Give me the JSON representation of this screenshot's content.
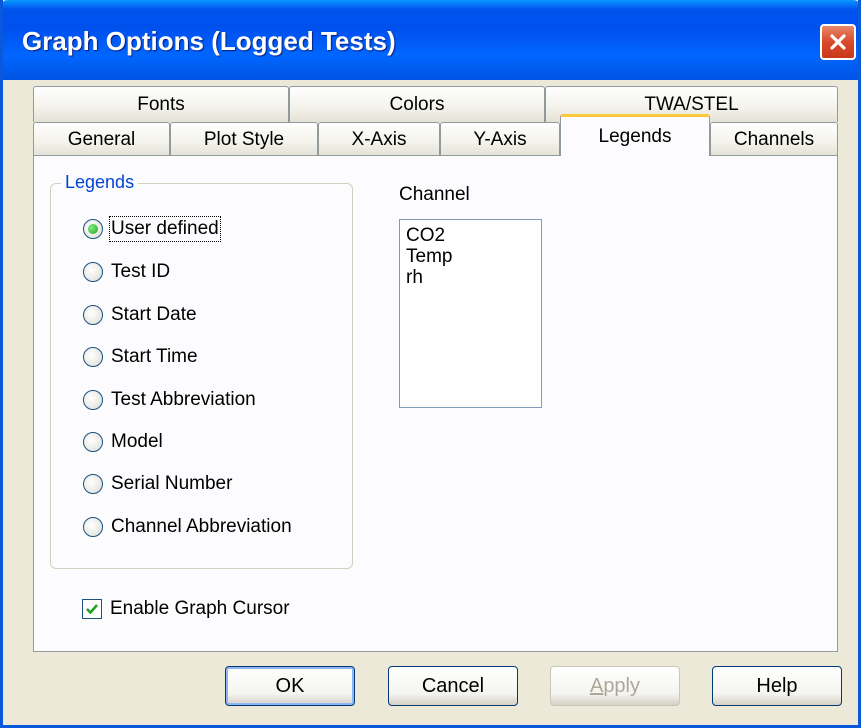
{
  "window": {
    "title": "Graph Options (Logged Tests)"
  },
  "tabs": {
    "row_back": [
      "Fonts",
      "Colors",
      "TWA/STEL"
    ],
    "row_front": [
      "General",
      "Plot Style",
      "X-Axis",
      "Y-Axis",
      "Legends",
      "Channels"
    ],
    "selected": "Legends"
  },
  "legends_group": {
    "label": "Legends",
    "options": [
      "User defined",
      "Test ID",
      "Start Date",
      "Start Time",
      "Test Abbreviation",
      "Model",
      "Serial Number",
      "Channel Abbreviation"
    ],
    "selected": "User defined"
  },
  "channel": {
    "label": "Channel",
    "items": [
      "CO2",
      "Temp",
      "rh"
    ]
  },
  "enable_cursor": {
    "label": "Enable Graph Cursor",
    "checked": true
  },
  "buttons": {
    "ok": "OK",
    "cancel": "Cancel",
    "apply": "Apply",
    "help": "Help"
  },
  "colors": {
    "titlebar": "#0054e3",
    "dialog_bg": "#ece9d8",
    "selected_tab_accent": "#ffc83c",
    "group_label": "#0046d5",
    "close_button": "#d94a2a"
  },
  "icons": {
    "close": "close-icon",
    "radio": "radio-icon",
    "checkbox": "checkmark-icon"
  }
}
